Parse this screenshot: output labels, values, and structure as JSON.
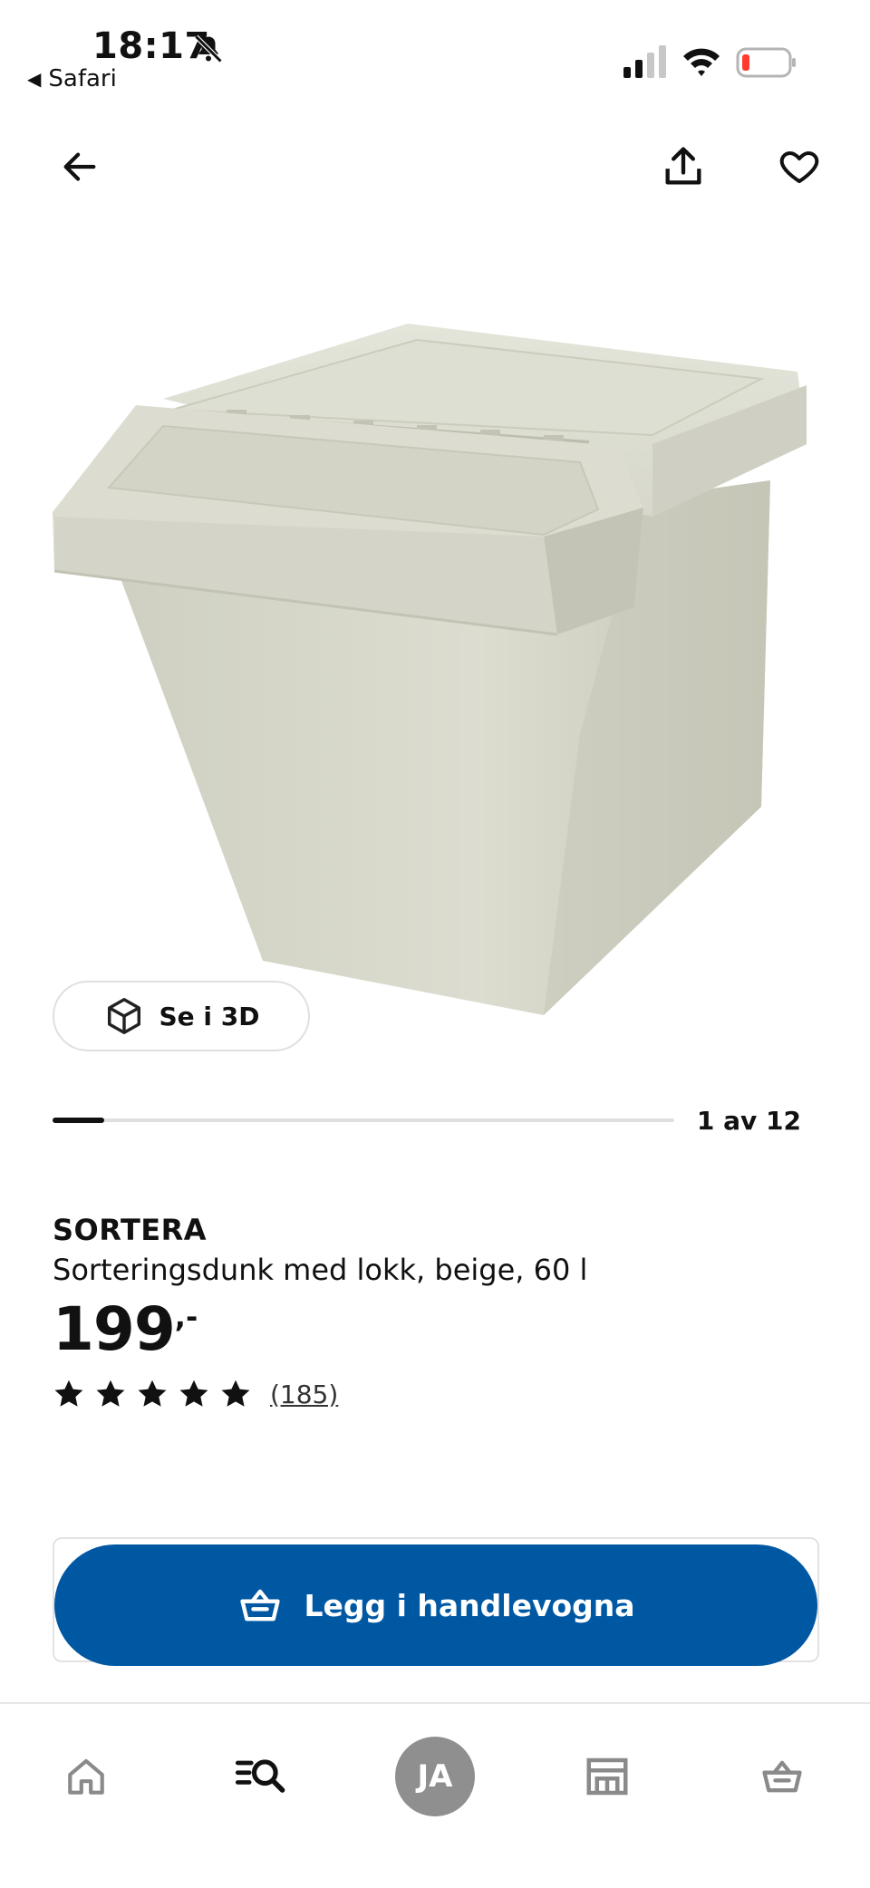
{
  "status_bar": {
    "time": "18:17",
    "back_app": "Safari",
    "icons": [
      "bell-muted-icon",
      "signal-icon",
      "wifi-icon",
      "battery-low-icon"
    ]
  },
  "nav": {
    "back_icon": "arrow-left-icon",
    "share_icon": "share-icon",
    "favorite_icon": "heart-icon"
  },
  "gallery": {
    "view_3d_label": "Se i 3D",
    "position_label": "1 av 12",
    "current": 1,
    "total": 12
  },
  "product": {
    "brand": "SORTERA",
    "description": "Sorteringsdunk med lokk, beige, 60 l",
    "price": "199",
    "price_suffix": ",-",
    "rating": 5,
    "rating_max": 5,
    "review_count": "(185)"
  },
  "cart": {
    "label": "Legg i handlevogna",
    "color": "#0058a3"
  },
  "tabbar": {
    "items": [
      "home-icon",
      "search-list-icon",
      "profile-avatar",
      "store-icon",
      "cart-icon"
    ],
    "avatar_initials": "JA"
  }
}
